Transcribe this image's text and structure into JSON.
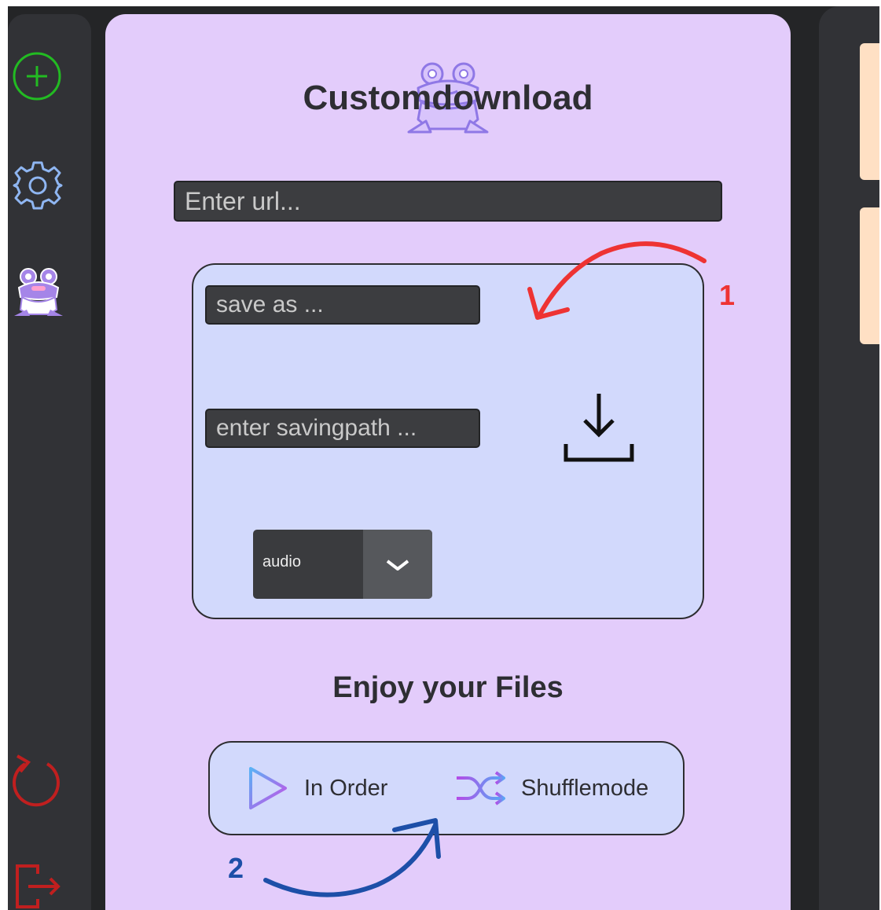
{
  "main": {
    "title": "Customdownload",
    "url_placeholder": "Enter url...",
    "save_as_placeholder": "save as ...",
    "saving_path_placeholder": "enter savingpath ...",
    "format_selected": "audio",
    "enjoy_heading": "Enjoy your Files",
    "modes": [
      "In Order",
      "Shufflemode"
    ]
  },
  "annotations": [
    "1",
    "2"
  ],
  "sidebar": {
    "icons": [
      "add-circle-icon",
      "gear-icon",
      "frog-icon",
      "refresh-icon",
      "logout-icon"
    ]
  },
  "colors": {
    "accent_purple": "#e3ccfb",
    "panel_blue": "#d2d9fc",
    "sidebar": "#313236",
    "add_green": "#22bb22",
    "danger_red": "#cc2222",
    "annotation_red": "#ee3333",
    "annotation_blue": "#1d4fa8",
    "peach": "#ffe0c4"
  }
}
